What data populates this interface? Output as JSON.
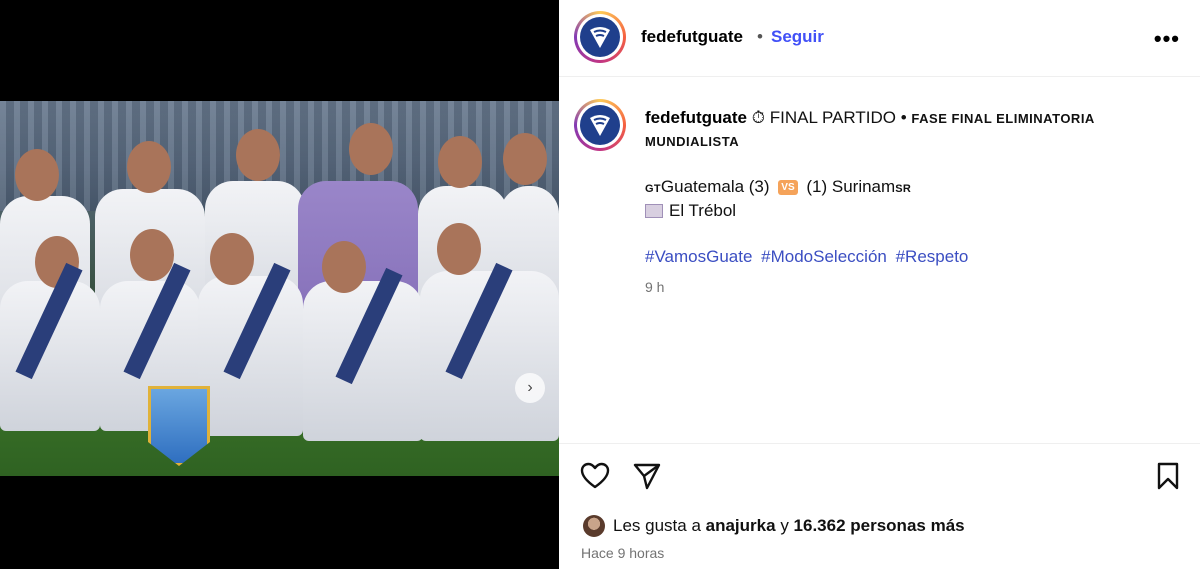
{
  "post": {
    "account": "fedefutguate",
    "separator": "•",
    "follow_label": "Seguir",
    "more_label": "•••"
  },
  "caption": {
    "timer_emoji": "⏱",
    "headline": "FINAL PARTIDO",
    "bullet": "•",
    "phase": "FASE FINAL ELIMINATORIA MUNDIALISTA",
    "home_flag": "GT",
    "home_team": "Guatemala (3)",
    "vs": "VS",
    "away_team": "(1) Surinam",
    "away_flag": "SR",
    "stadium": "El Trébol",
    "hashtags": [
      "#VamosGuate",
      "#ModoSelección",
      "#Respeto"
    ],
    "time": "9 h"
  },
  "media": {
    "next_icon": "›",
    "dots_total": 7,
    "dots_active": 2
  },
  "actions": {
    "like_icon": "heart-icon",
    "share_icon": "send-icon",
    "save_icon": "bookmark-icon"
  },
  "likes": {
    "prefix": "Les gusta a",
    "liker": "anajurka",
    "connector": "y",
    "count": "16.362 personas más"
  },
  "ago": "Hace 9 horas",
  "colors": {
    "link": "#3b4ec2",
    "follow": "#4150f7",
    "muted": "#737373"
  }
}
